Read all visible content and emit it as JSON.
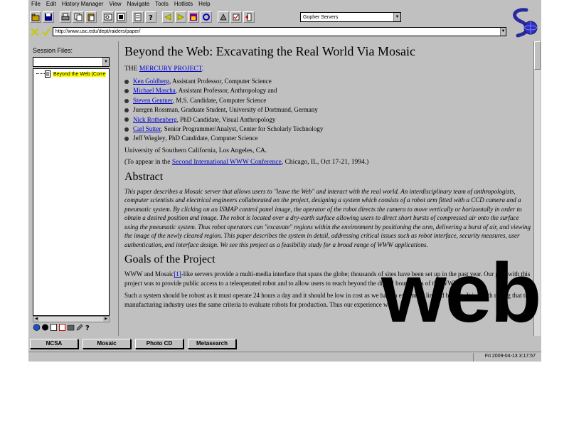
{
  "menubar": [
    "File",
    "Edit",
    "History Manager",
    "View",
    "Navigate",
    "Tools",
    "Hotlists",
    "Help"
  ],
  "toolbar": {
    "gopher_select": "Gopher Servers",
    "icons": [
      "open-folder-icon",
      "save-icon",
      "print-icon",
      "copy-icon",
      "paste-icon",
      "find-icon",
      "image-icon",
      "document-icon",
      "info-icon",
      "back-arrow-icon",
      "forward-arrow-icon",
      "home-icon",
      "reload-icon",
      "bookmark-icon",
      "hotlist-icon",
      "exit-icon"
    ]
  },
  "url": {
    "value": "http://www.usc.edu/dept/raiders/paper/"
  },
  "session": {
    "label": "Session Files:",
    "file": "Beyond the Web (Corre"
  },
  "content": {
    "title": "Beyond the Web: Excavating the Real World Via Mosaic",
    "project_prefix": "THE ",
    "project_link": "MERCURY PROJECT",
    "project_suffix": ".",
    "people": [
      {
        "name": "Ken Goldberg",
        "linked": true,
        "role": ", Assistant Professor, Computer Science"
      },
      {
        "name": "Michael Mascha",
        "linked": true,
        "role": ", Assistant Professor, Anthropology and"
      },
      {
        "name": "Steven Gentner",
        "linked": true,
        "role": ", M.S. Candidate, Computer Science"
      },
      {
        "name": "Juergen Rossman",
        "linked": false,
        "role": ", Graduate Student, University of Dortmund, Germany"
      },
      {
        "name": "Nick Rothenberg",
        "linked": true,
        "role": ", PhD Candidate, Visual Anthropology"
      },
      {
        "name": "Carl Sutter",
        "linked": true,
        "role": ", Senior Programmer/Analyst, Center for Scholarly Technology"
      },
      {
        "name": "Jeff Wiegley",
        "linked": false,
        "role": ", PhD Candidate, Computer Science"
      }
    ],
    "university": "University of Southern California, Los Angeles, CA.",
    "appear_prefix": "(To appear in the ",
    "appear_link": "Second International WWW Conference",
    "appear_suffix": ", Chicago, IL, Oct 17-21, 1994.)",
    "abstract_heading": "Abstract",
    "abstract_text": "This paper describes a Mosaic server that allows users to \"leave the Web\" and interact with the real world. An interdisciplinary team of anthropologists, computer scientists and electrical engineers collaborated on the project, designing a system which consists of a robot arm fitted with a CCD camera and a pneumatic system. By clicking on an ISMAP control panel image, the operator of the robot directs the camera to move vertically or horizontally in order to obtain a desired position and image. The robot is located over a dry-earth surface allowing users to direct short bursts of compressed air onto the surface using the pneumatic system. Thus robot operators can \"excavate\" regions within the environment by positioning the arm, delivering a burst of air, and viewing the image of the newly cleared region. This paper describes the system in detail, addressing critical issues such as robot interface, security measures, user authentication, and interface design. We see this project as a feasibility study for a broad range of WWW applications.",
    "goals_heading": "Goals of the Project",
    "goals_p1_a": "WWW and Mosaic",
    "goals_p1_ref": "[1]",
    "goals_p1_b": "-like servers provide a multi-media interface that spans the globe; thousands of sites have been set up in the past year. Our goal with this project was to provide public access to a teleoperated robot and to allow users to reach beyond the digital boundaries of the WWW.",
    "goals_p2": "Such a system should be robust as it must operate 24 hours a day and it should be low in cost as we had an extremely limited budget. It is worth noting that the manufacturing industry uses the same criteria to evaluate robots for production. Thus our experience with"
  },
  "watermark": "web",
  "bottom_buttons": [
    "NCSA",
    "Mosaic",
    "Photo CD",
    "Metasearch"
  ],
  "status": {
    "clock": "Fri 2009-04-13 3:17:57"
  }
}
